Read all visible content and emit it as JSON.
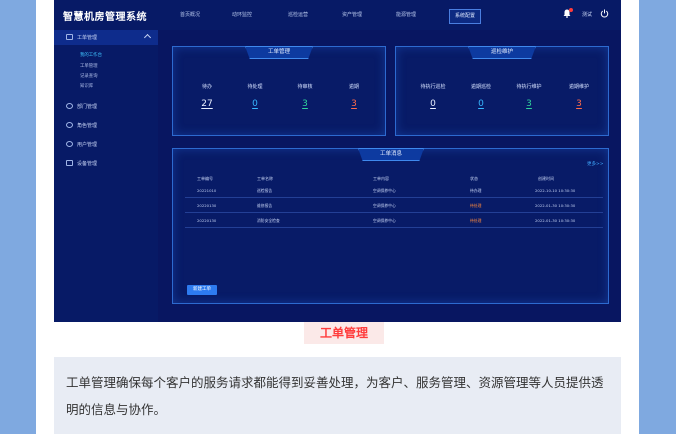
{
  "header": {
    "logo": "智慧机房管理系统",
    "nav": [
      "首页概况",
      "动环监控",
      "巡检运营",
      "资产管理",
      "能源管理",
      "系统配置"
    ],
    "active_index": 5,
    "user": "测试"
  },
  "sidebar": {
    "sections": [
      {
        "label": "工单管理",
        "expanded": true,
        "children": [
          "我的工作台",
          "工单管理",
          "记录查询",
          "知识库"
        ],
        "active_child": 0
      },
      {
        "label": "部门管理"
      },
      {
        "label": "角色管理"
      },
      {
        "label": "用户管理"
      },
      {
        "label": "设备管理"
      }
    ]
  },
  "workorder_panel": {
    "title": "工单管理",
    "stats": [
      {
        "label": "待办",
        "value": "27",
        "color": "#e9efff"
      },
      {
        "label": "待处理",
        "value": "0",
        "color": "#37b7ff"
      },
      {
        "label": "待审核",
        "value": "3",
        "color": "#2fd39c"
      },
      {
        "label": "逾期",
        "value": "3",
        "color": "#ff6b4a"
      }
    ]
  },
  "inspection_panel": {
    "title": "巡检维护",
    "stats": [
      {
        "label": "待执行巡检",
        "value": "0",
        "color": "#e9efff"
      },
      {
        "label": "逾期巡检",
        "value": "0",
        "color": "#37b7ff"
      },
      {
        "label": "待执行维护",
        "value": "3",
        "color": "#2fd39c"
      },
      {
        "label": "逾期维护",
        "value": "3",
        "color": "#ff6b4a"
      }
    ]
  },
  "message_panel": {
    "title": "工单消息",
    "more": "更多>>",
    "columns": [
      "工单编号",
      "工单名称",
      "工单内容",
      "状态",
      "创建时间"
    ],
    "rows": [
      [
        "20221010",
        "巡检报告",
        "空调保养中心",
        "待办理",
        "2022-10-10 10:30:30"
      ],
      [
        "20220130",
        "维修报告",
        "空调保养中心",
        "待处理",
        "2022-01-30 10:30:30"
      ],
      [
        "20220130",
        "消防安全检查",
        "空调保养中心",
        "待处理",
        "2022-01-30 10:30:30"
      ]
    ],
    "new_button": "新建工单"
  },
  "caption": "工单管理",
  "description": "工单管理确保每个客户的服务请求都能得到妥善处理，为客户、服务管理、资源管理等人员提供透明的信息与协作。"
}
